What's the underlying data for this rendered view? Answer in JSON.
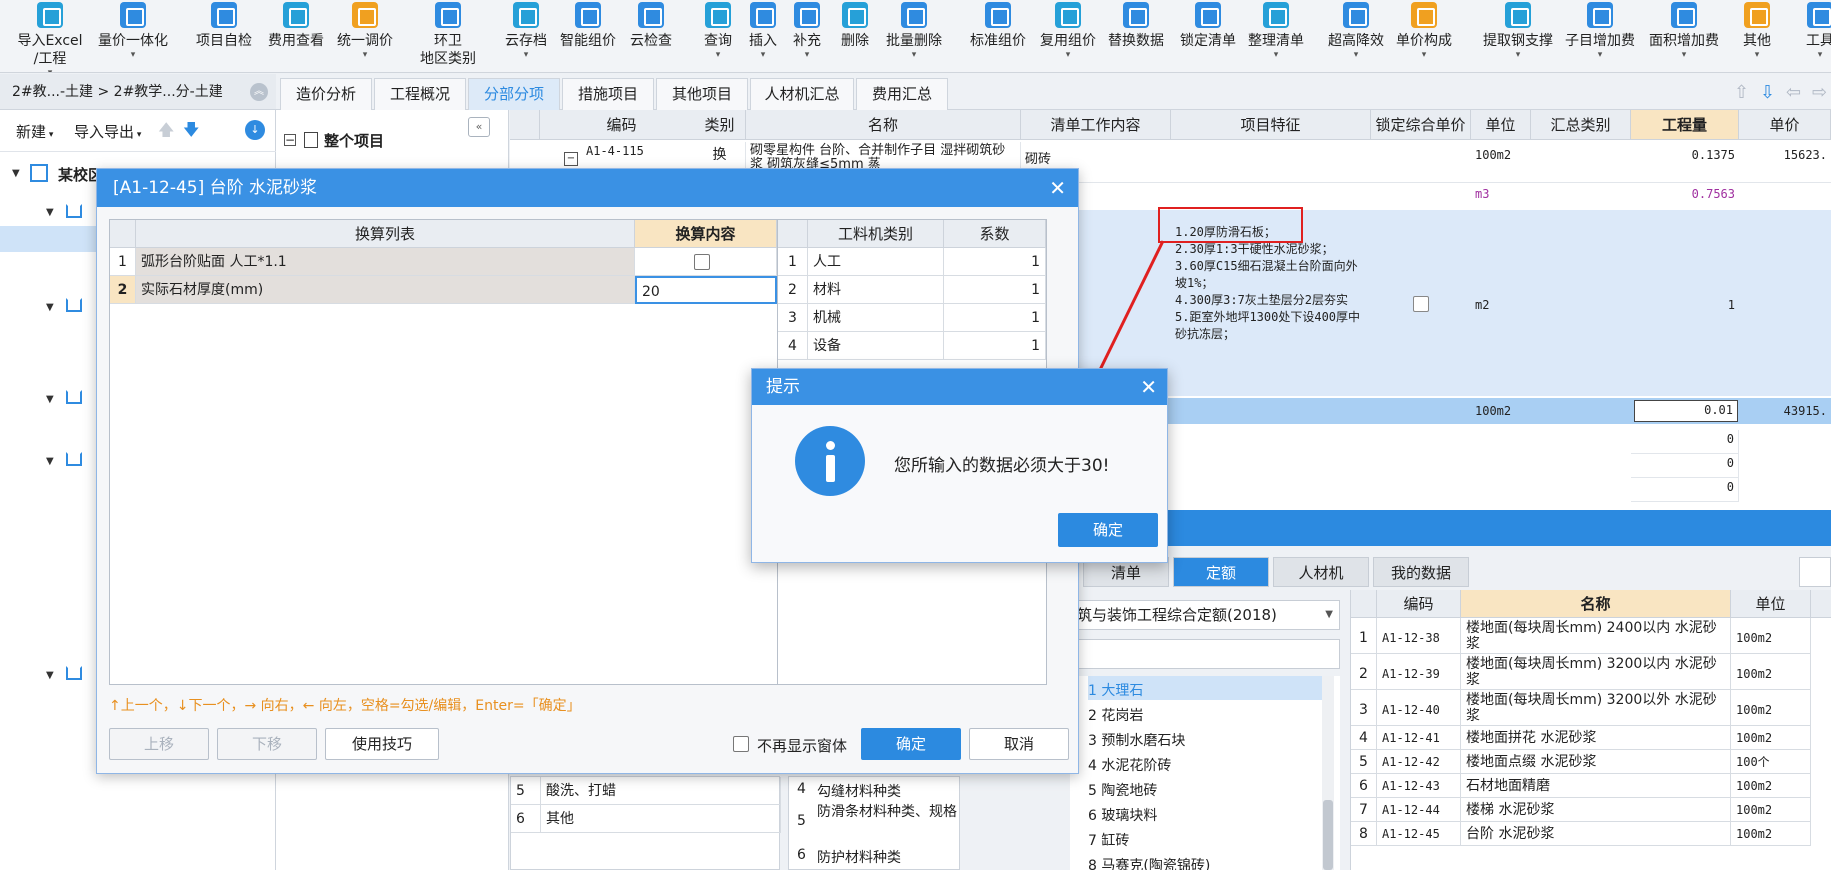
{
  "toolbar": {
    "items": [
      {
        "l1": "导入Excel",
        "l2": "/工程",
        "arr": "▾"
      },
      {
        "l1": "量价一体化",
        "l2": "",
        "arr": "▾"
      },
      {
        "l1": "项目自检",
        "l2": "",
        "arr": ""
      },
      {
        "l1": "费用查看",
        "l2": "",
        "arr": ""
      },
      {
        "l1": "统一调价",
        "l2": "",
        "arr": "▾"
      },
      {
        "l1": "环卫",
        "l2": "地区类别",
        "arr": ""
      },
      {
        "l1": "云存档",
        "l2": "",
        "arr": "▾"
      },
      {
        "l1": "智能组价",
        "l2": "",
        "arr": ""
      },
      {
        "l1": "云检查",
        "l2": "",
        "arr": ""
      },
      {
        "l1": "查询",
        "l2": "",
        "arr": "▾"
      },
      {
        "l1": "插入",
        "l2": "",
        "arr": "▾"
      },
      {
        "l1": "补充",
        "l2": "",
        "arr": "▾"
      },
      {
        "l1": "删除",
        "l2": "",
        "arr": ""
      },
      {
        "l1": "批量删除",
        "l2": "",
        "arr": "▾"
      },
      {
        "l1": "标准组价",
        "l2": "",
        "arr": ""
      },
      {
        "l1": "复用组价",
        "l2": "",
        "arr": "▾"
      },
      {
        "l1": "替换数据",
        "l2": "",
        "arr": ""
      },
      {
        "l1": "锁定清单",
        "l2": "",
        "arr": ""
      },
      {
        "l1": "整理清单",
        "l2": "",
        "arr": "▾"
      },
      {
        "l1": "超高降效",
        "l2": "",
        "arr": "▾"
      },
      {
        "l1": "单价构成",
        "l2": "",
        "arr": "▾"
      },
      {
        "l1": "提取钢支撑",
        "l2": "",
        "arr": "▾"
      },
      {
        "l1": "子目增加费",
        "l2": "",
        "arr": "▾"
      },
      {
        "l1": "面积增加费",
        "l2": "",
        "arr": "▾"
      },
      {
        "l1": "其他",
        "l2": "",
        "arr": "▾"
      },
      {
        "l1": "工具",
        "l2": "",
        "arr": "▾"
      }
    ]
  },
  "breadcrumb": "2#教...-土建 > 2#教学...分-土建",
  "tabs": [
    "造价分析",
    "工程概况",
    "分部分项",
    "措施项目",
    "其他项目",
    "人材机汇总",
    "费用汇总"
  ],
  "left_panel": {
    "new_label": "新建",
    "io_label": "导入导出",
    "root_label": "某校区"
  },
  "mid_panel": {
    "root_item": "整个项目",
    "features": [
      {
        "n": "5",
        "t": "酸洗、打蜡"
      },
      {
        "n": "6",
        "t": "其他"
      }
    ],
    "feature_types": [
      {
        "n": "4",
        "t": "勾缝材料种类"
      },
      {
        "n": "5",
        "t": "防滑条材料种类、规格"
      },
      {
        "n": "6",
        "t": "防护材料种类"
      }
    ]
  },
  "grid": {
    "headers": [
      "编码",
      "类别",
      "名称",
      "清单工作内容",
      "项目特征",
      "锁定综合单价",
      "单位",
      "汇总类别",
      "工程量",
      "单价"
    ],
    "row1": {
      "code": "A1-4-115",
      "type": "换",
      "name": "砌零星构件 台阶、合并制作子目 湿拌砌筑砂浆 砌筑灰缝≤5mm 蒸",
      "work": "砌砖",
      "unit": "100m2",
      "qty": "0.1375",
      "price": "15623."
    },
    "row2": {
      "unit": "m3",
      "qty": "0.7563"
    },
    "row3": {
      "feature": "1.20厚防滑石板；\n2.30厚1:3干硬性水泥砂浆；\n3.60厚C15细石混凝土台阶面向外坡1%；\n4.300厚3:7灰土垫层分2层夯实\n5.距室外地坪1300处下设400厚中砂抗冻层；",
      "unit": "m2",
      "qty": "1"
    },
    "row4": {
      "unit": "100m2",
      "qty": "0.01",
      "price": "43915."
    },
    "zero_rows": [
      "0",
      "0",
      "0"
    ]
  },
  "lower": {
    "tabs": [
      "清单",
      "定额",
      "人材机",
      "我的数据"
    ],
    "quota_db": "筑与装饰工程综合定额(2018)",
    "categories": [
      "1 大理石",
      "2 花岗岩",
      "3 预制水磨石块",
      "4 水泥花阶砖",
      "5 陶瓷地砖",
      "6 玻璃块料",
      "7 缸砖",
      "8 马赛克(陶瓷锦砖)"
    ],
    "headers": [
      "编码",
      "名称",
      "单位"
    ],
    "rows": [
      {
        "n": "1",
        "code": "A1-12-38",
        "name": "楼地面(每块周长mm) 2400以内 水泥砂浆",
        "unit": "100m2"
      },
      {
        "n": "2",
        "code": "A1-12-39",
        "name": "楼地面(每块周长mm) 3200以内 水泥砂浆",
        "unit": "100m2"
      },
      {
        "n": "3",
        "code": "A1-12-40",
        "name": "楼地面(每块周长mm) 3200以外 水泥砂浆",
        "unit": "100m2"
      },
      {
        "n": "4",
        "code": "A1-12-41",
        "name": "楼地面拼花 水泥砂浆",
        "unit": "100m2"
      },
      {
        "n": "5",
        "code": "A1-12-42",
        "name": "楼地面点缀 水泥砂浆",
        "unit": "100个"
      },
      {
        "n": "6",
        "code": "A1-12-43",
        "name": "石材地面精磨",
        "unit": "100m2"
      },
      {
        "n": "7",
        "code": "A1-12-44",
        "name": "楼梯 水泥砂浆",
        "unit": "100m2"
      },
      {
        "n": "8",
        "code": "A1-12-45",
        "name": "台阶 水泥砂浆",
        "unit": "100m2"
      }
    ]
  },
  "dialog": {
    "title": "[A1-12-45] 台阶 水泥砂浆",
    "conv_headers": [
      "换算列表",
      "换算内容"
    ],
    "conv_rows": [
      {
        "n": "1",
        "name": "弧形台阶贴面 人工*1.1",
        "value": ""
      },
      {
        "n": "2",
        "name": "实际石材厚度(mm)",
        "value": "20"
      }
    ],
    "factor_headers": [
      "工料机类别",
      "系数"
    ],
    "factor_rows": [
      {
        "n": "1",
        "name": "人工",
        "v": "1"
      },
      {
        "n": "2",
        "name": "材料",
        "v": "1"
      },
      {
        "n": "3",
        "name": "机械",
        "v": "1"
      },
      {
        "n": "4",
        "name": "设备",
        "v": "1"
      }
    ],
    "hint": "↑上一个，↓下一个，→ 向右，← 向左，空格=勾选/编辑，Enter=「确定」",
    "prev": "上移",
    "next": "下移",
    "tips": "使用技巧",
    "no_show": "不再显示窗体",
    "ok": "确定",
    "cancel": "取消"
  },
  "alert": {
    "title": "提示",
    "message": "您所输入的数据必须大于30!",
    "ok": "确定"
  },
  "colors": {
    "accent": "#2c8ae0",
    "highlight": "#f9e5c2",
    "annotation": "#e02020"
  }
}
